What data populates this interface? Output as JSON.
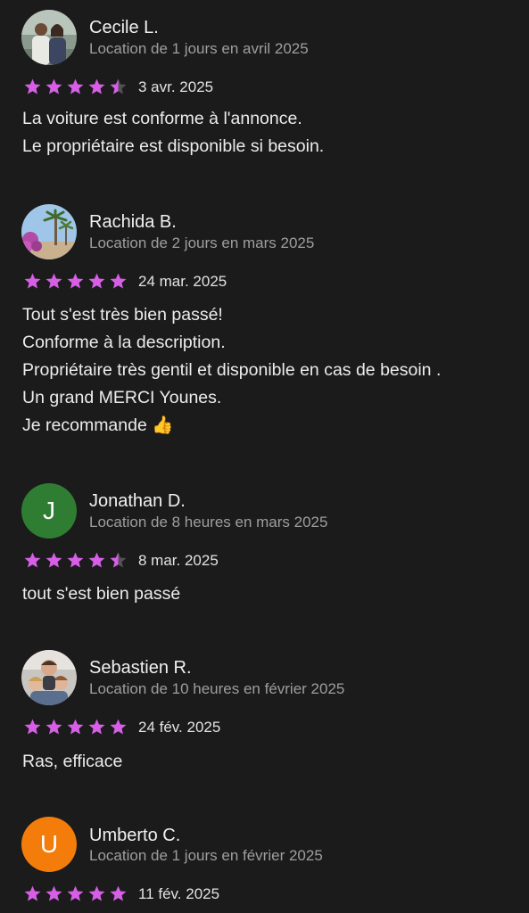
{
  "colors": {
    "background": "#1b1b1c",
    "star": "#d65fe6",
    "avatar_j": "#2f7d32",
    "avatar_u": "#f47c0a"
  },
  "reviews": [
    {
      "name": "Cecile L.",
      "subtitle": "Location de 1 jours en avril 2025",
      "rating": 4.5,
      "date": "3 avr. 2025",
      "avatar": "photo",
      "lines": [
        "La voiture est conforme à l'annonce.",
        "Le propriétaire est disponible si besoin."
      ]
    },
    {
      "name": "Rachida B.",
      "subtitle": "Location de 2 jours en mars 2025",
      "rating": 5,
      "date": "24 mar. 2025",
      "avatar": "photo",
      "lines": [
        "Tout s'est très bien passé!",
        "Conforme à la description.",
        "Propriétaire très gentil et disponible en cas de besoin .",
        "Un grand MERCI Younes.",
        "Je recommande 👍"
      ]
    },
    {
      "name": "Jonathan D.",
      "subtitle": "Location de 8 heures en mars 2025",
      "rating": 4.5,
      "date": "8 mar. 2025",
      "avatar": "J",
      "lines": [
        "tout s'est bien passé"
      ]
    },
    {
      "name": "Sebastien R.",
      "subtitle": "Location de 10 heures en février 2025",
      "rating": 5,
      "date": "24 fév. 2025",
      "avatar": "photo",
      "lines": [
        "Ras, efficace"
      ]
    },
    {
      "name": "Umberto C.",
      "subtitle": "Location de 1 jours en février 2025",
      "rating": 5,
      "date": "11 fév. 2025",
      "avatar": "U",
      "lines": []
    }
  ]
}
